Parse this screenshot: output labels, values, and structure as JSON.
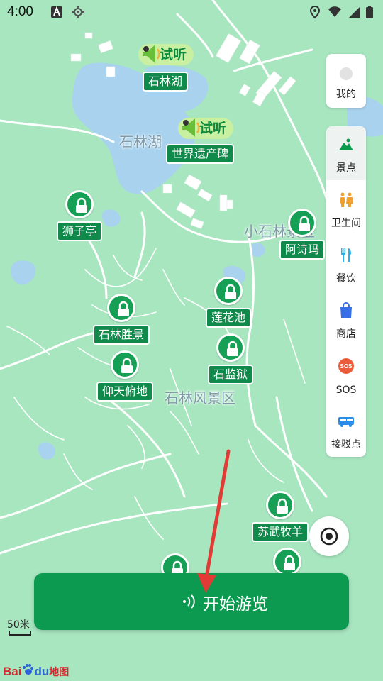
{
  "status_bar": {
    "time": "4:00"
  },
  "map": {
    "area_labels": [
      {
        "id": "lake-area",
        "text": "石林湖"
      },
      {
        "id": "small-forest",
        "text": "小石林景区"
      },
      {
        "id": "scenic-area",
        "text": "石林风景区"
      }
    ],
    "audition_badges": [
      {
        "id": "audition-1",
        "text": "试听"
      },
      {
        "id": "audition-2",
        "text": "试听"
      }
    ],
    "pois": [
      {
        "id": "shilinhu",
        "label": "石林湖",
        "locked": false
      },
      {
        "id": "world-heritage",
        "label": "世界遗产碑",
        "locked": false
      },
      {
        "id": "shizi",
        "label": "狮子亭",
        "locked": true
      },
      {
        "id": "ashima",
        "label": "阿诗玛",
        "locked": true
      },
      {
        "id": "lianhua",
        "label": "莲花池",
        "locked": true
      },
      {
        "id": "shengjing",
        "label": "石林胜景",
        "locked": true
      },
      {
        "id": "shijianyu",
        "label": "石监狱",
        "locked": true
      },
      {
        "id": "yangtian",
        "label": "仰天俯地",
        "locked": true
      },
      {
        "id": "suwu",
        "label": "苏武牧羊",
        "locked": true
      }
    ]
  },
  "sidebar": {
    "profile_label": "我的",
    "items": [
      {
        "label": "景点",
        "icon": "mountain-icon",
        "active": true
      },
      {
        "label": "卫生间",
        "icon": "restroom-icon",
        "active": false
      },
      {
        "label": "餐饮",
        "icon": "dining-icon",
        "active": false
      },
      {
        "label": "商店",
        "icon": "shopping-bag-icon",
        "active": false
      },
      {
        "label": "SOS",
        "icon": "sos-icon",
        "active": false
      },
      {
        "label": "接驳点",
        "icon": "bus-icon",
        "active": false
      }
    ]
  },
  "start_button": {
    "label": "开始游览"
  },
  "scale": {
    "label": "50米"
  },
  "logo": {
    "part1": "Bai",
    "part2": "du",
    "part3": "地图"
  },
  "colors": {
    "map_bg": "#a8e6c0",
    "lake": "#a8d2ee",
    "accent": "#0c9a50",
    "road": "#ffffff"
  }
}
